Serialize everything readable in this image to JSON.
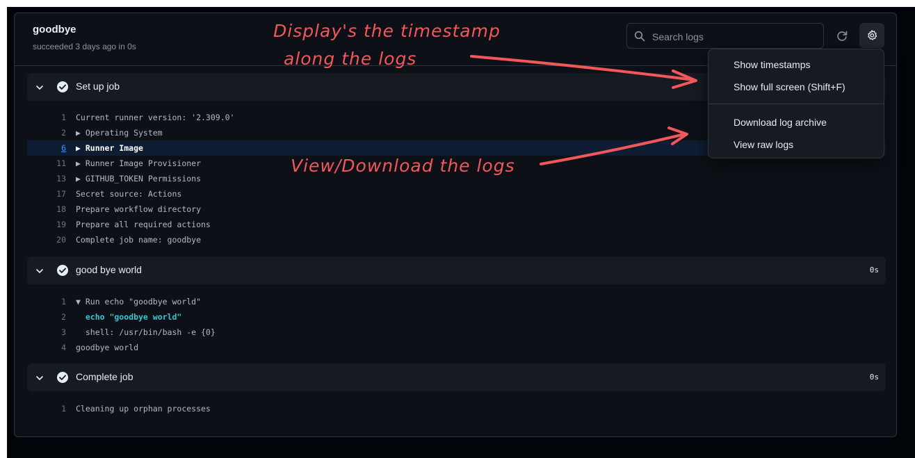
{
  "job": {
    "title": "goodbye",
    "subtitle": "succeeded 3 days ago in 0s"
  },
  "search": {
    "placeholder": "Search logs"
  },
  "icons": {
    "search": "search-icon",
    "refresh": "refresh-icon",
    "settings": "gear-icon",
    "collapse": "chevron-down-icon",
    "status": "check-circle-icon"
  },
  "colors": {
    "status_success": "#e6edf3",
    "annotation": "#f2575a",
    "link": "#4493f8"
  },
  "sections": [
    {
      "title": "Set up job",
      "duration": "",
      "lines": [
        {
          "num": "1",
          "text": "Current runner version: '2.309.0'"
        },
        {
          "num": "2",
          "text": "▶ Operating System"
        },
        {
          "num": "6",
          "text": "▶ Runner Image"
        },
        {
          "num": "11",
          "text": "▶ Runner Image Provisioner"
        },
        {
          "num": "13",
          "text": "▶ GITHUB_TOKEN Permissions"
        },
        {
          "num": "17",
          "text": "Secret source: Actions"
        },
        {
          "num": "18",
          "text": "Prepare workflow directory"
        },
        {
          "num": "19",
          "text": "Prepare all required actions"
        },
        {
          "num": "20",
          "text": "Complete job name: goodbye"
        }
      ]
    },
    {
      "title": "good bye world",
      "duration": "0s",
      "lines": [
        {
          "num": "1",
          "text": "▼ Run echo \"goodbye world\""
        },
        {
          "num": "2",
          "text": "  echo \"goodbye world\""
        },
        {
          "num": "3",
          "text": "  shell: /usr/bin/bash -e {0}"
        },
        {
          "num": "4",
          "text": "goodbye world"
        }
      ]
    },
    {
      "title": "Complete job",
      "duration": "0s",
      "lines": [
        {
          "num": "1",
          "text": "Cleaning up orphan processes"
        }
      ]
    }
  ],
  "menu": {
    "items": [
      "Show timestamps",
      "Show full screen (Shift+F)",
      "Download log archive",
      "View raw logs"
    ]
  },
  "annotations": {
    "timestamp_line1": "Display's the timestamp",
    "timestamp_line2": "along the logs",
    "logs": "View/Download the logs"
  }
}
